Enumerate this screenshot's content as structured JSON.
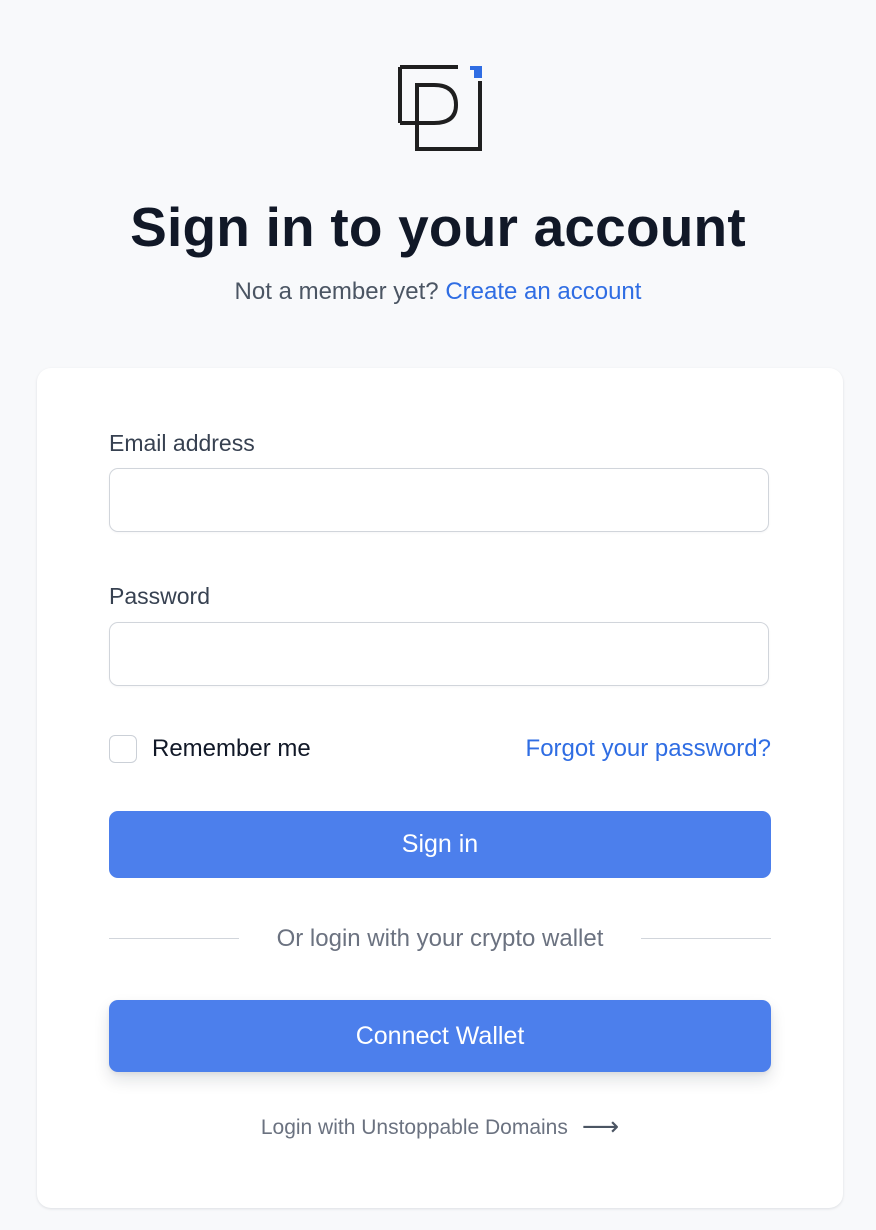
{
  "logo": {
    "icon": "dp-logo-icon",
    "accent_color": "#2f6de3",
    "color": "#1f1f1f"
  },
  "header": {
    "title": "Sign in to your account",
    "subtitle_text": "Not a member yet?",
    "create_account_link": "Create an account"
  },
  "form": {
    "email_label": "Email address",
    "email_value": "",
    "password_label": "Password",
    "password_value": "",
    "remember_label": "Remember me",
    "remember_checked": false,
    "forgot_link": "Forgot your password?",
    "signin_button": "Sign in",
    "divider_text": "Or login with your crypto wallet",
    "connect_wallet_button": "Connect Wallet",
    "ud_link": "Login with Unstoppable Domains",
    "ud_arrow_icon": "arrow-right-icon"
  },
  "colors": {
    "accent": "#4c7fec",
    "link": "#2f6de3",
    "background": "#f8f9fb",
    "card": "#ffffff"
  }
}
